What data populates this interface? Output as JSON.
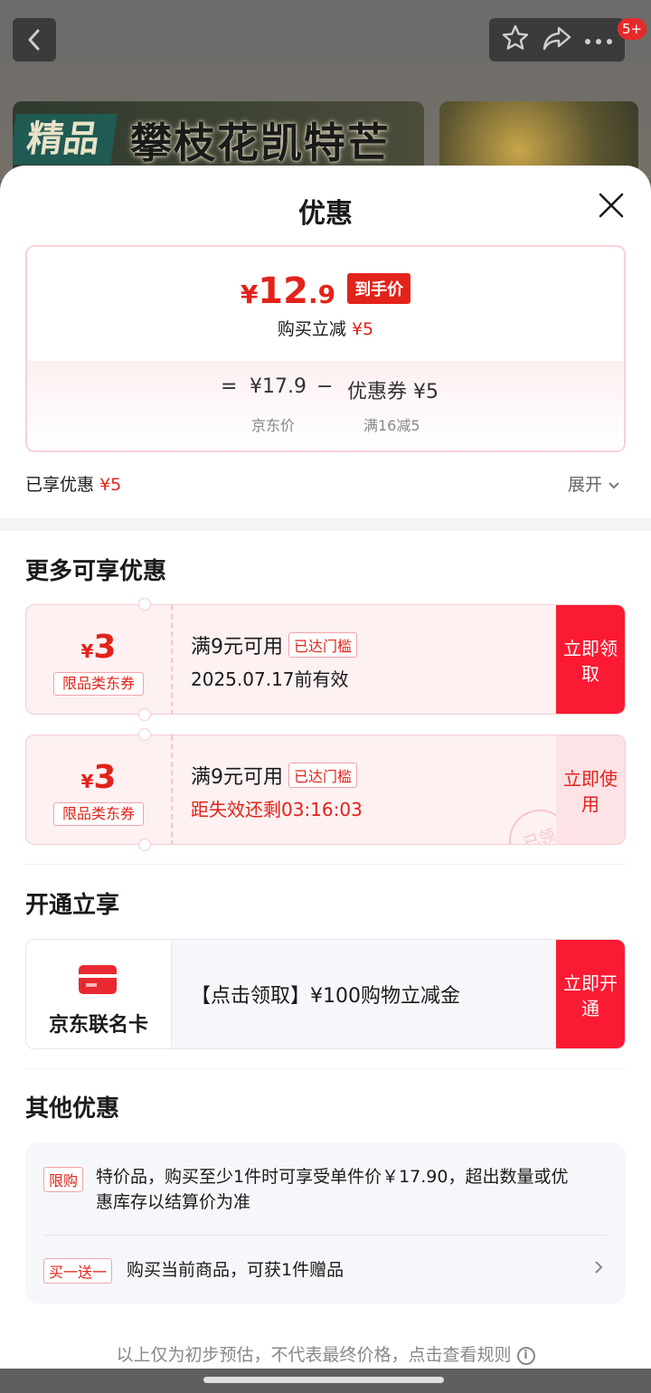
{
  "top": {
    "badge": "5+",
    "banner_tag": "精品",
    "banner_text": "攀枝花凯特芒"
  },
  "sheet": {
    "title": "优惠",
    "price_card": {
      "currency": "¥",
      "price_int": "12",
      "price_dec": ".9",
      "price_tag": "到手价",
      "direct_cut_label": "购买立减",
      "direct_cut_value": "¥5",
      "eq": "=",
      "jd_price": "¥17.9",
      "minus": "−",
      "coupon_amount": "优惠券 ¥5",
      "jd_price_label": "京东价",
      "coupon_condition": "满16减5"
    },
    "enjoyed_label": "已享优惠",
    "enjoyed_value": "¥5",
    "expand_label": "展开",
    "more_title": "更多可享优惠",
    "coupons": [
      {
        "currency": "¥",
        "amount": "3",
        "category": "限品类东券",
        "condition": "满9元可用",
        "reached": "已达门槛",
        "validity": "2025.07.17前有效",
        "action": "立即领取"
      },
      {
        "currency": "¥",
        "amount": "3",
        "category": "限品类东券",
        "condition": "满9元可用",
        "reached": "已达门槛",
        "validity": "距失效还剩03:16:03",
        "action": "立即使用",
        "stamp": "已领"
      }
    ],
    "open_title": "开通立享",
    "card": {
      "name": "京东联名卡",
      "desc": "【点击领取】¥100购物立减金",
      "action": "立即开通"
    },
    "other_title": "其他优惠",
    "other": [
      {
        "tag": "限购",
        "text": "特价品，购买至少1件时可享受单件价￥17.90，超出数量或优惠库存以结算价为准"
      },
      {
        "tag": "买一送一",
        "text": "购买当前商品，可获1件赠品"
      }
    ],
    "footer_note": "以上仅为初步预估，不代表最终价格，点击查看规则",
    "info_glyph": "i"
  },
  "colors": {
    "accent_red": "#e2231a",
    "button_red": "#fb1a33"
  }
}
